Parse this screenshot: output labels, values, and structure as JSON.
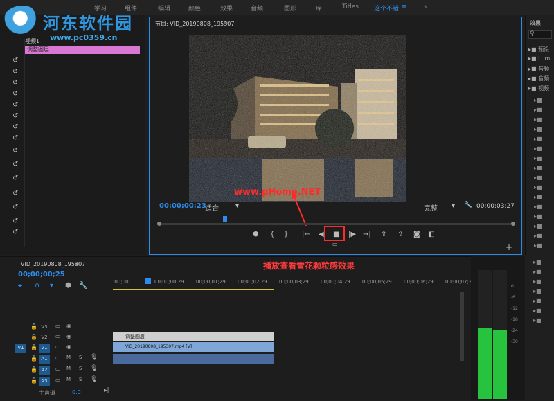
{
  "watermark": {
    "title": "河东软件园",
    "url": "www.pc0359.cn"
  },
  "workspaces": [
    "学习",
    "组件",
    "编辑",
    "颜色",
    "效果",
    "音频",
    "图形",
    "库",
    "Titles",
    "这个不错",
    "≡",
    "»"
  ],
  "left_panel": {
    "clip_label": "视频1",
    "layer_label": "调整图层"
  },
  "program_monitor": {
    "title": "节目: VID_20190808_195307",
    "menu_icon": "≡",
    "timecode_current": "00;00;00;23",
    "fit_label": "适合",
    "quality_label": "完整",
    "timecode_duration": "00;00;03;27"
  },
  "annotations": {
    "monitor_watermark": "www.pHome.NET",
    "timeline_note": "播放查看雪花颗粒感效果"
  },
  "effects_panel": {
    "title": "效果",
    "items": [
      "预设",
      "Lum",
      "音频",
      "音频",
      "视频"
    ]
  },
  "timeline": {
    "sequence_name": "VID_20190808_195307",
    "timecode": "00;00;00;25",
    "ruler": [
      ":00;00",
      "00;00;00;29",
      "00;00;01;29",
      "00;00;02;29",
      "00;00;03;29",
      "00;00;04;29",
      "00;00;05;29",
      "00;00;06;29",
      "00;00;07;29"
    ],
    "video_tracks": [
      "V3",
      "V2",
      "V1"
    ],
    "audio_tracks": [
      "A1",
      "A2",
      "A3"
    ],
    "source_v": "V1",
    "clips": {
      "adjustment": "调整图层",
      "video": "VID_20190808_195307.mp4 [V]"
    },
    "master_label": "主声道",
    "master_value": "0.0",
    "playhead_fraction": 0.0
  },
  "audio_meter": {
    "scale": [
      "0",
      "-6",
      "-12",
      "-18",
      "-24",
      "-30"
    ],
    "level_left": 0.55,
    "level_right": 0.53
  },
  "icons": [
    "marker-icon",
    "in-icon",
    "out-icon",
    "go-to-in-icon",
    "step-back-icon",
    "stop-icon",
    "step-forward-icon",
    "go-to-out-icon",
    "lift-icon",
    "extract-icon",
    "camera-icon",
    "compare-icon",
    "wrench-icon",
    "plus-icon"
  ]
}
